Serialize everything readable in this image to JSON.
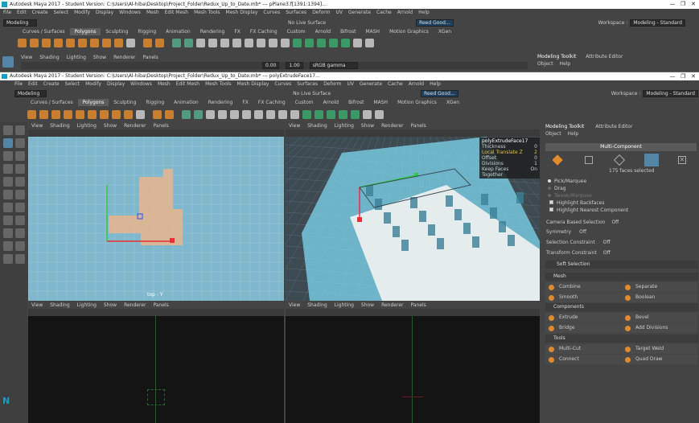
{
  "back_window": {
    "title": "Autodesk Maya 2017 - Student Version: C:\\Users\\Al-hiba\\Desktop\\Project_Folder\\Redux_Up_to_Date.mb* --- pPlane3.f[1391:1394]...",
    "menu": [
      "File",
      "Edit",
      "Create",
      "Select",
      "Modify",
      "Display",
      "Windows",
      "Mesh",
      "Edit Mesh",
      "Mesh Tools",
      "Mesh Display",
      "Curves",
      "Surfaces",
      "Deform",
      "UV",
      "Generate",
      "Cache",
      "Arnold",
      "Help"
    ],
    "mode": "Modeling",
    "live_surface": "No Live Surface",
    "user": "Reed Good...",
    "workspace_label": "Workspace :",
    "workspace": "Modeling - Standard",
    "shelf_tabs": [
      "Curves / Surfaces",
      "Polygons",
      "Sculpting",
      "Rigging",
      "Animation",
      "Rendering",
      "FX",
      "FX Caching",
      "Custom",
      "Arnold",
      "Bifrost",
      "MASH",
      "Motion Graphics",
      "XGen"
    ],
    "vp_menu": [
      "View",
      "Shading",
      "Lighting",
      "Show",
      "Renderer",
      "Panels"
    ],
    "field_a": "0.00",
    "field_b": "1.00",
    "color_space": "sRGB gamma",
    "tabs": [
      "Modeling Toolkit",
      "Attribute Editor"
    ],
    "sub_menu": [
      "Object",
      "Help"
    ]
  },
  "front_window": {
    "title": "Autodesk Maya 2017 - Student Version: C:\\Users\\Al-hiba\\Desktop\\Project_Folder\\Redux_Up_to_Date.mb* --- polyExtrudeFace17...",
    "menu": [
      "File",
      "Edit",
      "Create",
      "Select",
      "Modify",
      "Display",
      "Windows",
      "Mesh",
      "Edit Mesh",
      "Mesh Tools",
      "Mesh Display",
      "Curves",
      "Surfaces",
      "Deform",
      "UV",
      "Generate",
      "Cache",
      "Arnold",
      "Help"
    ],
    "mode": "Modeling",
    "live_surface": "No Live Surface",
    "user": "Reed Good...",
    "workspace_label": "Workspace :",
    "workspace": "Modeling - Standard",
    "shelf_tabs": [
      "Curves / Surfaces",
      "Polygons",
      "Sculpting",
      "Rigging",
      "Animation",
      "Rendering",
      "FX",
      "FX Caching",
      "Custom",
      "Arnold",
      "Bifrost",
      "MASH",
      "Motion Graphics",
      "XGen"
    ],
    "active_shelf": "Polygons"
  },
  "viewports": {
    "menu": [
      "View",
      "Shading",
      "Lighting",
      "Show",
      "Renderer",
      "Panels"
    ],
    "top_left_label": "top - Y",
    "field_value": "0.0"
  },
  "channel_box": {
    "title": "polyExtrudeFace17",
    "rows": [
      {
        "name": "Thickness",
        "value": "0"
      },
      {
        "name": "Local Translate Z",
        "value": "2"
      },
      {
        "name": "Offset",
        "value": "0"
      },
      {
        "name": "Divisions",
        "value": "1"
      },
      {
        "name": "Keep Faces Together",
        "value": "On"
      }
    ]
  },
  "toolkit": {
    "tabs": [
      "Modeling Toolkit",
      "Attribute Editor"
    ],
    "sub_menu": [
      "Object",
      "Help"
    ],
    "mode_button": "Multi-Component",
    "faces_selected": "175 faces selected",
    "pick_options": [
      "Pick/Marquee",
      "Drag",
      "Tweak/Marquee"
    ],
    "checks": [
      "Highlight Backfaces",
      "Highlight Nearest Component"
    ],
    "camera_based": "Camera Based Selection",
    "camera_based_val": "Off",
    "symmetry": "Symmetry",
    "symmetry_val": "Off",
    "selection_constraint": "Selection Constraint",
    "selection_constraint_val": "Off",
    "transform_constraint": "Transform Constraint",
    "transform_constraint_val": "Off",
    "soft_selection": "Soft Selection",
    "mesh_header": "Mesh",
    "mesh_buttons": [
      "Combine",
      "Separate",
      "Smooth",
      "Boolean"
    ],
    "components_header": "Components",
    "components_buttons": [
      "Extrude",
      "Bevel",
      "Bridge",
      "Add Divisions"
    ],
    "tools_header": "Tools",
    "tools_buttons": [
      "Multi-Cut",
      "Target Weld",
      "Connect",
      "Quad Draw"
    ]
  },
  "colors": {
    "accent": "#5285a6",
    "mesh_blue": "#7fd8f0",
    "peach": "#e8b48c",
    "ortho_bg": "#7fb8cc",
    "dark_bg": "#141414"
  }
}
